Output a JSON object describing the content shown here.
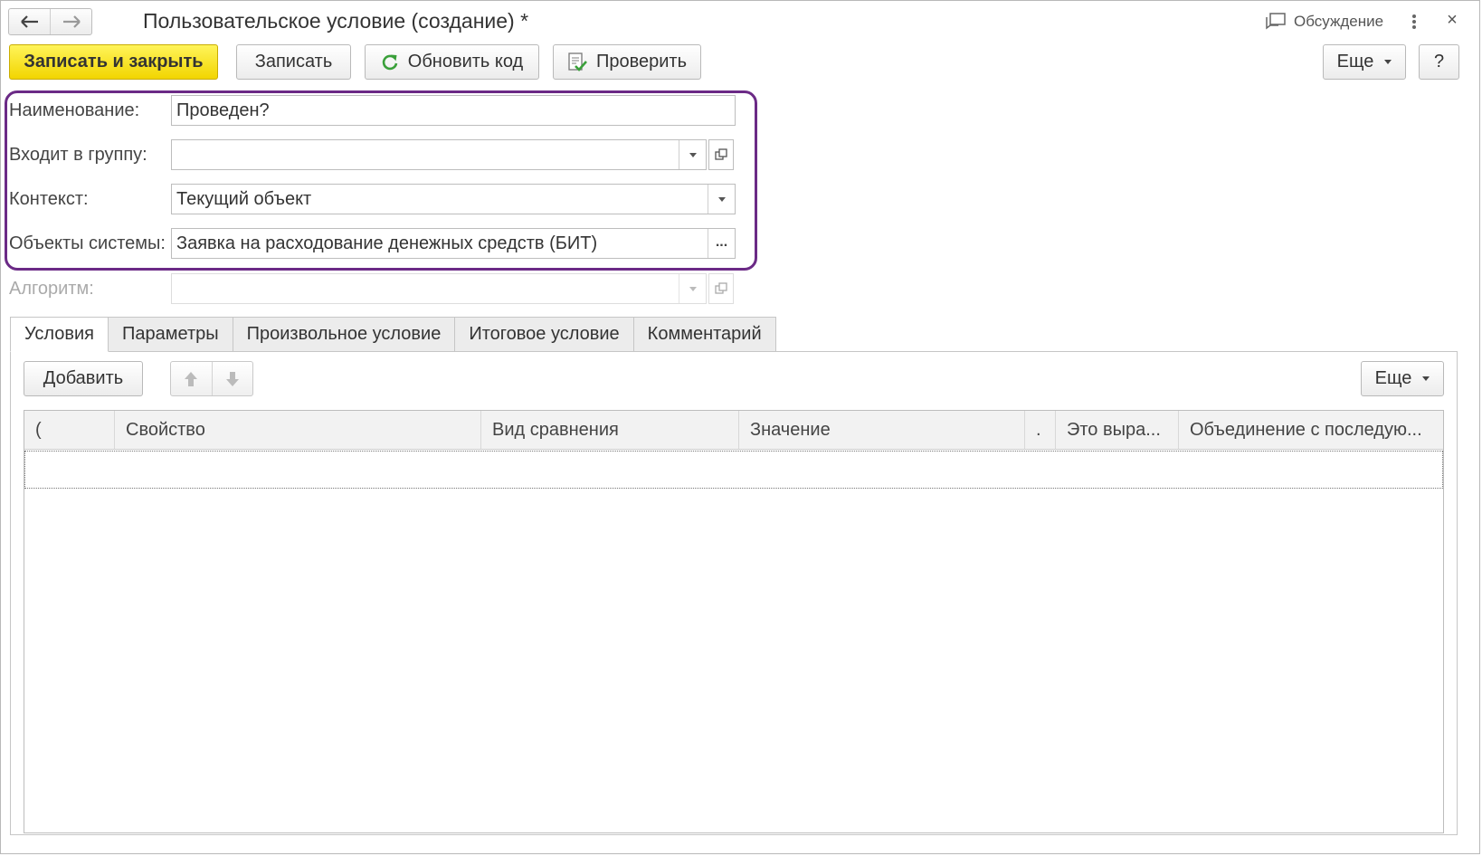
{
  "window": {
    "title": "Пользовательское условие (создание) *",
    "discussion_label": "Обсуждение",
    "close_glyph": "×"
  },
  "toolbar": {
    "save_close_label": "Записать и закрыть",
    "save_label": "Записать",
    "refresh_code_label": "Обновить код",
    "check_label": "Проверить",
    "more_label": "Еще",
    "help_label": "?"
  },
  "form": {
    "name_label": "Наименование:",
    "name_value": "Проведен?",
    "group_label": "Входит в группу:",
    "group_value": "",
    "context_label": "Контекст:",
    "context_value": "Текущий объект",
    "objects_label": "Объекты системы:",
    "objects_value": "Заявка на расходование денежных средств (БИТ)",
    "objects_button": "...",
    "algorithm_label": "Алгоритм:",
    "algorithm_value": ""
  },
  "tabs": [
    "Условия",
    "Параметры",
    "Произвольное условие",
    "Итоговое условие",
    "Комментарий"
  ],
  "active_tab": "Условия",
  "conditions": {
    "add_label": "Добавить",
    "more_label": "Еще",
    "columns": [
      "(",
      "Свойство",
      "Вид сравнения",
      "Значение",
      ".",
      "Это выра...",
      "Объединение с последую..."
    ],
    "rows": []
  },
  "colors": {
    "primary_button": "#f2d500",
    "highlight_border": "#6b2a86",
    "refresh_icon": "#3aa03a"
  }
}
